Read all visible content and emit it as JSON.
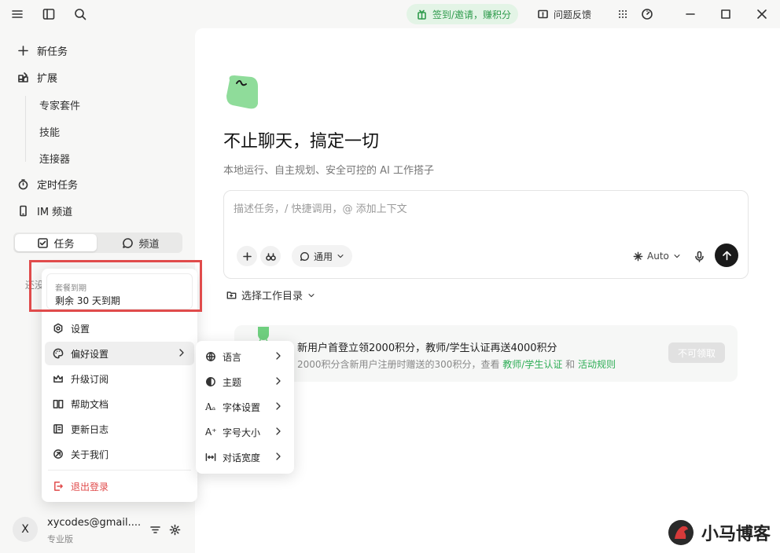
{
  "topbar": {
    "checkin_label": "签到/邀请，赚积分",
    "feedback_label": "问题反馈"
  },
  "sidebar": {
    "nav": [
      {
        "label": "新任务",
        "icon": "plus-icon"
      },
      {
        "label": "扩展",
        "icon": "extension-icon"
      },
      {
        "label": "定时任务",
        "icon": "timer-icon"
      },
      {
        "label": "IM 频道",
        "icon": "phone-icon"
      }
    ],
    "sub_items": [
      "专家套件",
      "技能",
      "连接器"
    ],
    "tabs": {
      "task": "任务",
      "channel": "频道"
    },
    "partial_text": "还没"
  },
  "main": {
    "title": "不止聊天，搞定一切",
    "subtitle": "本地运行、自主规划、安全可控的 AI 工作搭子",
    "composer": {
      "placeholder": "描述任务，/ 快捷调用，@ 添加上下文",
      "mode_label": "通用",
      "model_label": "Auto"
    },
    "workdir_label": "选择工作目录",
    "promo": {
      "title": "新用户首登立领2000积分，教师/学生认证再送4000积分",
      "sub_prefix": "2000积分含新用户注册时赠送的300积分，查看",
      "link1": "教师/学生认证",
      "sub_and": "和",
      "link2": "活动规则",
      "button": "不可领取"
    }
  },
  "menu": {
    "plan_label": "套餐到期",
    "plan_value": "剩余 30 天到期",
    "items": [
      {
        "label": "设置",
        "icon": "settings-icon"
      },
      {
        "label": "偏好设置",
        "icon": "palette-icon"
      },
      {
        "label": "升级订阅",
        "icon": "crown-icon"
      },
      {
        "label": "帮助文档",
        "icon": "book-icon"
      },
      {
        "label": "更新日志",
        "icon": "changelog-icon"
      },
      {
        "label": "关于我们",
        "icon": "about-icon"
      }
    ],
    "logout": "退出登录"
  },
  "submenu": {
    "items": [
      {
        "label": "语言",
        "icon": "globe-icon"
      },
      {
        "label": "主题",
        "icon": "theme-icon"
      },
      {
        "label": "字体设置",
        "icon": "font-icon"
      },
      {
        "label": "字号大小",
        "icon": "font-size-icon"
      },
      {
        "label": "对话宽度",
        "icon": "width-icon"
      }
    ]
  },
  "user": {
    "avatar_letter": "X",
    "email": "xycodes@gmail....",
    "plan": "专业版"
  },
  "watermark": "小马博客",
  "colors": {
    "accent_green": "#2fae57",
    "redbox": "#e04b4b",
    "logout_red": "#e04b4b"
  }
}
